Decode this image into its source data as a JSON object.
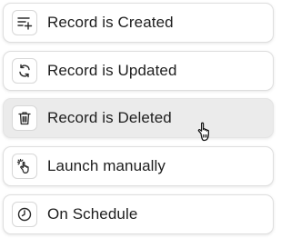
{
  "triggers": [
    {
      "label": "Record is Created",
      "icon": "list-add-icon",
      "state": "default"
    },
    {
      "label": "Record is Updated",
      "icon": "refresh-icon",
      "state": "default"
    },
    {
      "label": "Record is Deleted",
      "icon": "trash-icon",
      "state": "hovered"
    },
    {
      "label": "Launch manually",
      "icon": "tap-icon",
      "state": "default"
    },
    {
      "label": "On Schedule",
      "icon": "clock-icon",
      "state": "default"
    }
  ],
  "colors": {
    "text": "#1e1e1e",
    "card_border": "#dedede",
    "hover_background": "#ebebeb",
    "icon_stroke": "#2b2b2b"
  }
}
